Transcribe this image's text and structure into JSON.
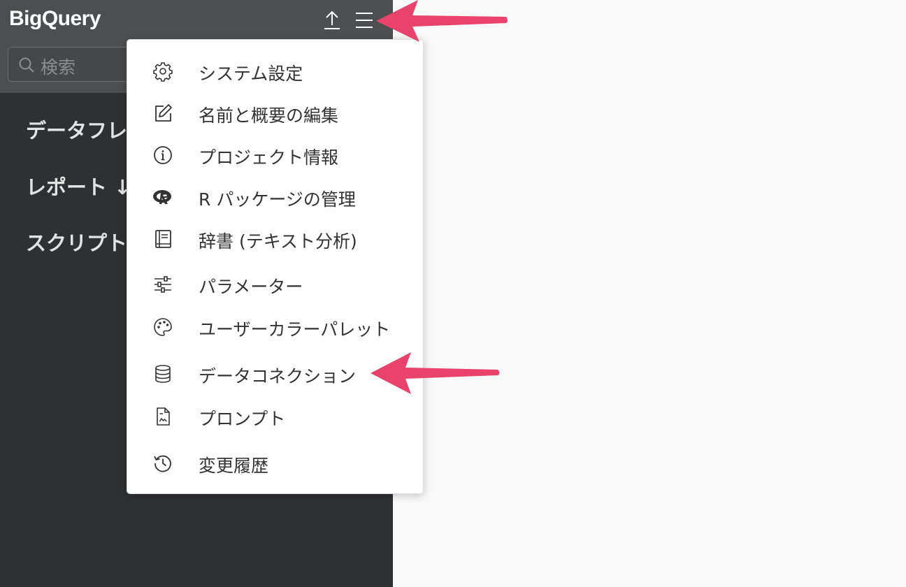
{
  "header": {
    "app_title": "BigQuery",
    "search_placeholder": "検索"
  },
  "sidebar": {
    "items": [
      {
        "label": "データフレ"
      },
      {
        "label": "レポート ↓"
      },
      {
        "label": "スクリプト"
      }
    ]
  },
  "menu": {
    "items": [
      {
        "label": "システム設定",
        "icon": "gear-icon"
      },
      {
        "label": "名前と概要の編集",
        "icon": "edit-icon"
      },
      {
        "label": "プロジェクト情報",
        "icon": "info-icon"
      },
      {
        "label": "R パッケージの管理",
        "icon": "r-logo-icon"
      },
      {
        "label": "辞書 (テキスト分析)",
        "icon": "book-icon"
      },
      {
        "label": "パラメーター",
        "icon": "sliders-icon"
      },
      {
        "label": "ユーザーカラーパレット",
        "icon": "palette-icon"
      },
      {
        "label": "データコネクション",
        "icon": "database-icon"
      },
      {
        "label": "プロンプト",
        "icon": "document-icon"
      },
      {
        "label": "変更履歴",
        "icon": "history-icon"
      }
    ]
  },
  "colors": {
    "sidebar_bg": "#2e3031",
    "topbar_bg": "#4c4e50",
    "annotation_arrow": "#e8436a"
  }
}
